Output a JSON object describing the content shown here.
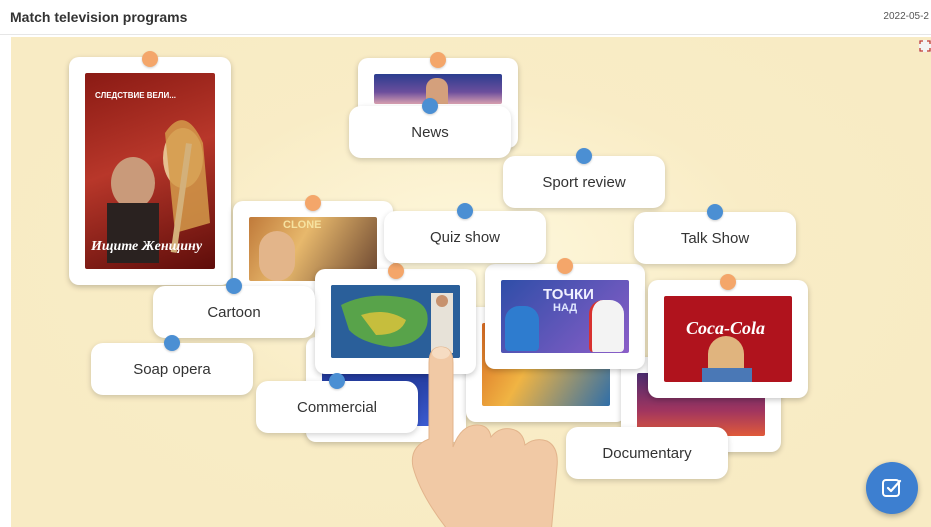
{
  "header": {
    "title": "Match television programs",
    "date": "2022-05-2"
  },
  "poster": {
    "line1": "СЛЕДСТВИЕ ВЕЛИ...",
    "line2": "Ищите Женщину"
  },
  "sport_photo_text": {
    "line1": "ТОЧКИ",
    "line2": "НАД"
  },
  "cola_text": "Coca-Cola",
  "clone_text": "CLONE",
  "labels": {
    "news": "News",
    "sport_review": "Sport review",
    "quiz_show": "Quiz show",
    "talk_show": "Talk Show",
    "cartoon": "Cartoon",
    "soap_opera": "Soap opera",
    "commercial": "Commercial",
    "documentary": "Documentary"
  },
  "colors": {
    "board": "#f8ebc4",
    "pin_orange": "#f4a66a",
    "pin_blue": "#4b8fd3",
    "check_button": "#3d7fd0"
  },
  "icons": {
    "check": "check-square-icon",
    "fullscreen": "fullscreen-icon",
    "hand": "pointing-hand-icon"
  }
}
